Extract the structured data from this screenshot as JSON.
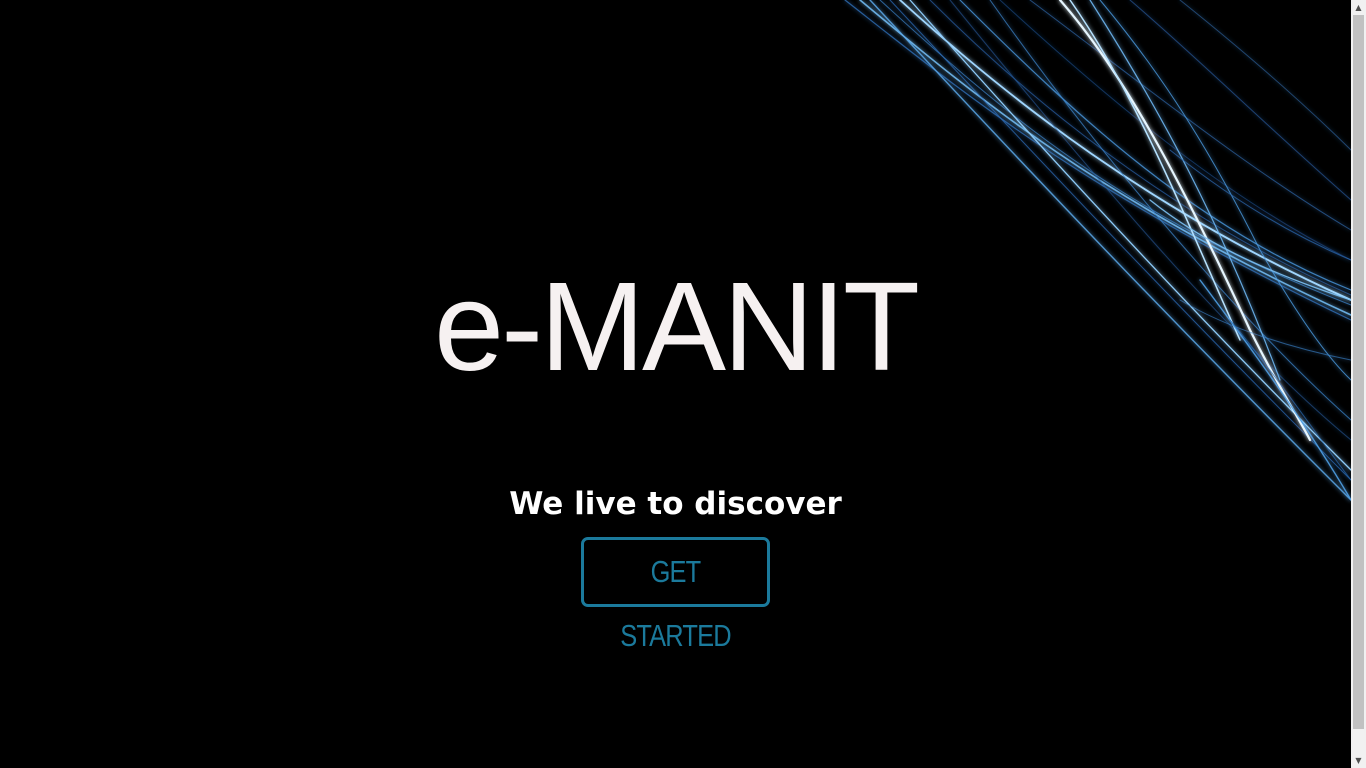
{
  "hero": {
    "brand": "e-MANIT",
    "tagline": "We live to discover",
    "cta_label": "GET STARTED"
  },
  "colors": {
    "background": "#000000",
    "brand_text": "#f6f1f1",
    "accent": "#1b7a9c",
    "streak": "#4aa3e8"
  },
  "icons": {
    "scroll_up": "triangle-up-icon",
    "scroll_down": "triangle-down-icon"
  }
}
